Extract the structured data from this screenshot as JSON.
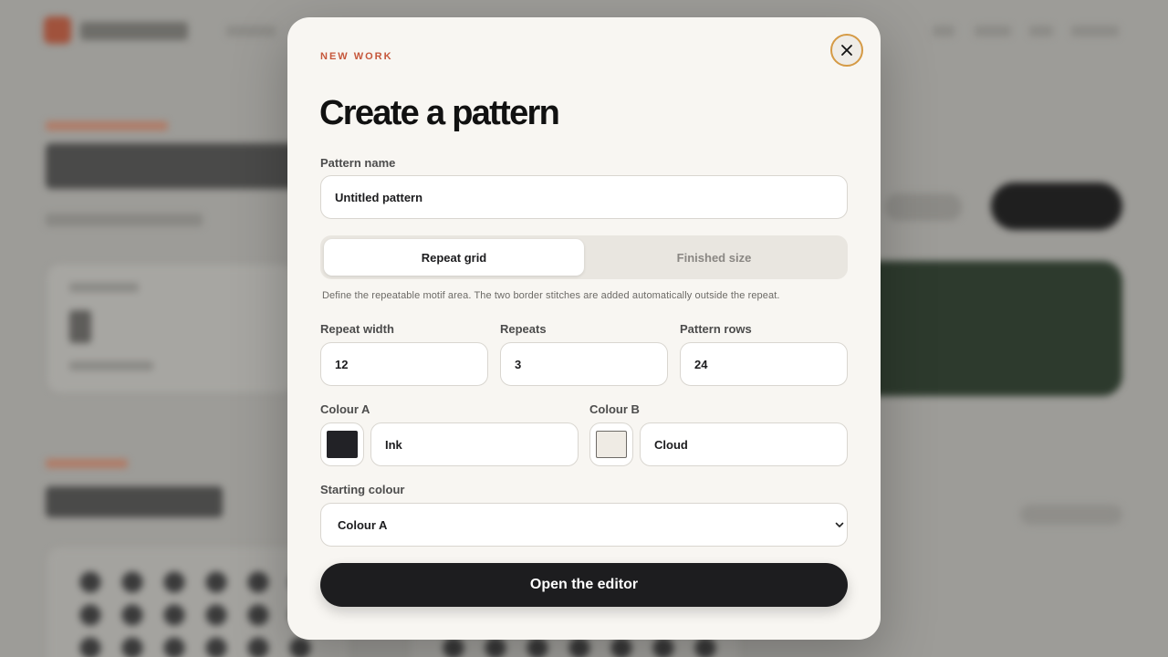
{
  "modal": {
    "eyebrow": "NEW WORK",
    "title": "Create a pattern",
    "close_icon": "close-icon",
    "pattern_name": {
      "label": "Pattern name",
      "value": "Untitled pattern"
    },
    "mode_tabs": [
      {
        "label": "Repeat grid",
        "active": true
      },
      {
        "label": "Finished size",
        "active": false
      }
    ],
    "hint": "Define the repeatable motif area. The two border stitches are added automatically outside the repeat.",
    "repeat_width": {
      "label": "Repeat width",
      "value": "12"
    },
    "repeats": {
      "label": "Repeats",
      "value": "3"
    },
    "pattern_rows": {
      "label": "Pattern rows",
      "value": "24"
    },
    "colour_a": {
      "label": "Colour A",
      "name": "Ink",
      "color": "#222226"
    },
    "colour_b": {
      "label": "Colour B",
      "name": "Cloud",
      "color": "#efebe4"
    },
    "starting_colour": {
      "label": "Starting colour",
      "value": "Colour A",
      "icon": "chevron-down-icon"
    },
    "submit_label": "Open the editor"
  },
  "colors": {
    "accent": "#c6573b",
    "focus_ring": "#d59a45",
    "cta_bg": "#1d1d1f",
    "backdrop_green": "#2d3a2d"
  }
}
